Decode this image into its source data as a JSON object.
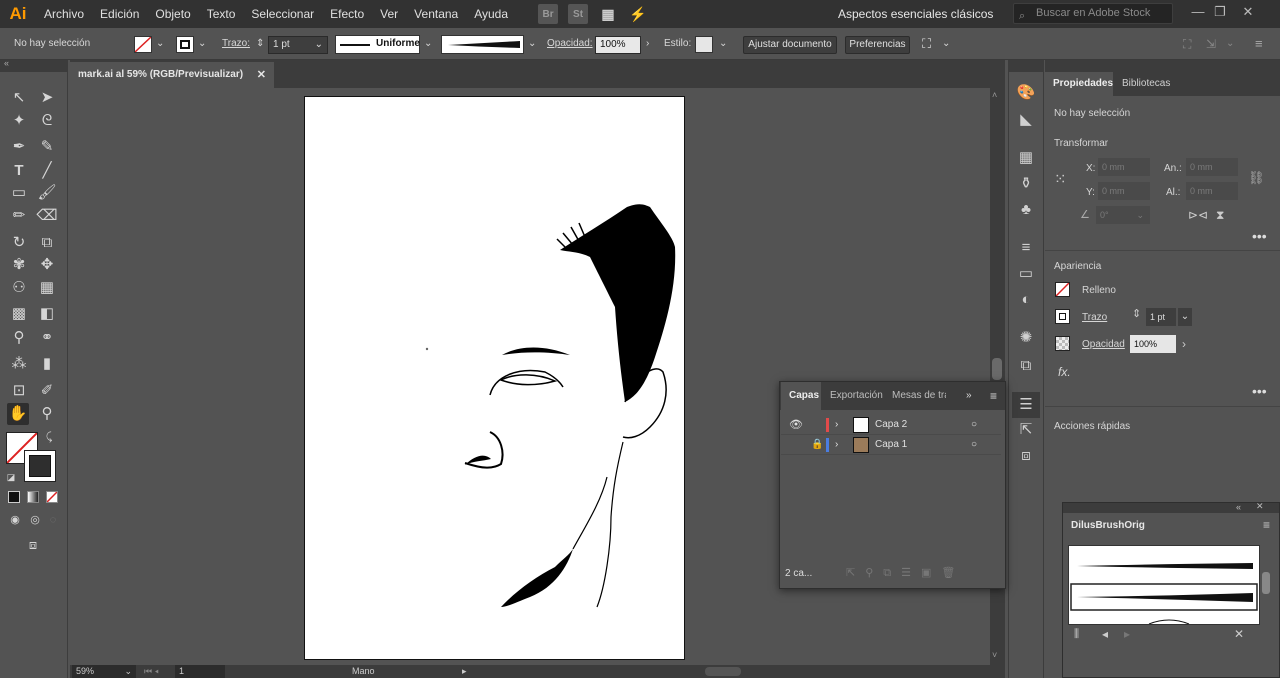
{
  "app": {
    "logo": "Ai"
  },
  "menu": [
    "Archivo",
    "Edición",
    "Objeto",
    "Texto",
    "Seleccionar",
    "Efecto",
    "Ver",
    "Ventana",
    "Ayuda"
  ],
  "bridge": {
    "br": "Br",
    "st": "St"
  },
  "workspace": "Aspectos esenciales clásicos",
  "search": {
    "placeholder": "Buscar en Adobe Stock"
  },
  "control": {
    "selection": "No hay selección",
    "stroke_label": "Trazo:",
    "stroke_value": "1 pt",
    "profile": "Uniforme",
    "opacity_label": "Opacidad:",
    "opacity_value": "100%",
    "style_label": "Estilo:",
    "adjust_btn": "Ajustar documento",
    "prefs_btn": "Preferencias"
  },
  "document": {
    "tab": "mark.ai al 59% (RGB/Previsualizar)"
  },
  "status": {
    "zoom": "59%",
    "page": "1",
    "tool": "Mano"
  },
  "props": {
    "tab1": "Propiedades",
    "tab2": "Bibliotecas",
    "no_selection": "No hay selección",
    "transform": "Transformar",
    "x": "X:",
    "y": "Y:",
    "w": "An.:",
    "h": "Al.:",
    "xv": "0 mm",
    "yv": "0 mm",
    "wv": "0 mm",
    "hv": "0 mm",
    "angle": "0°",
    "appearance": "Apariencia",
    "fill": "Relleno",
    "stroke": "Trazo",
    "stroke_value": "1 pt",
    "opacity": "Opacidad",
    "opacity_value": "100%",
    "fx": "fx.",
    "quick": "Acciones rápidas"
  },
  "layers": {
    "tab1": "Capas",
    "tab2": "Exportación",
    "tab3": "Mesas de tra",
    "rows": [
      {
        "name": "Capa 2",
        "color": "#e24a4a"
      },
      {
        "name": "Capa 1",
        "color": "#4a7de2"
      }
    ],
    "count": "2 ca..."
  },
  "brushes": {
    "tab": "DilusBrushOrig"
  }
}
